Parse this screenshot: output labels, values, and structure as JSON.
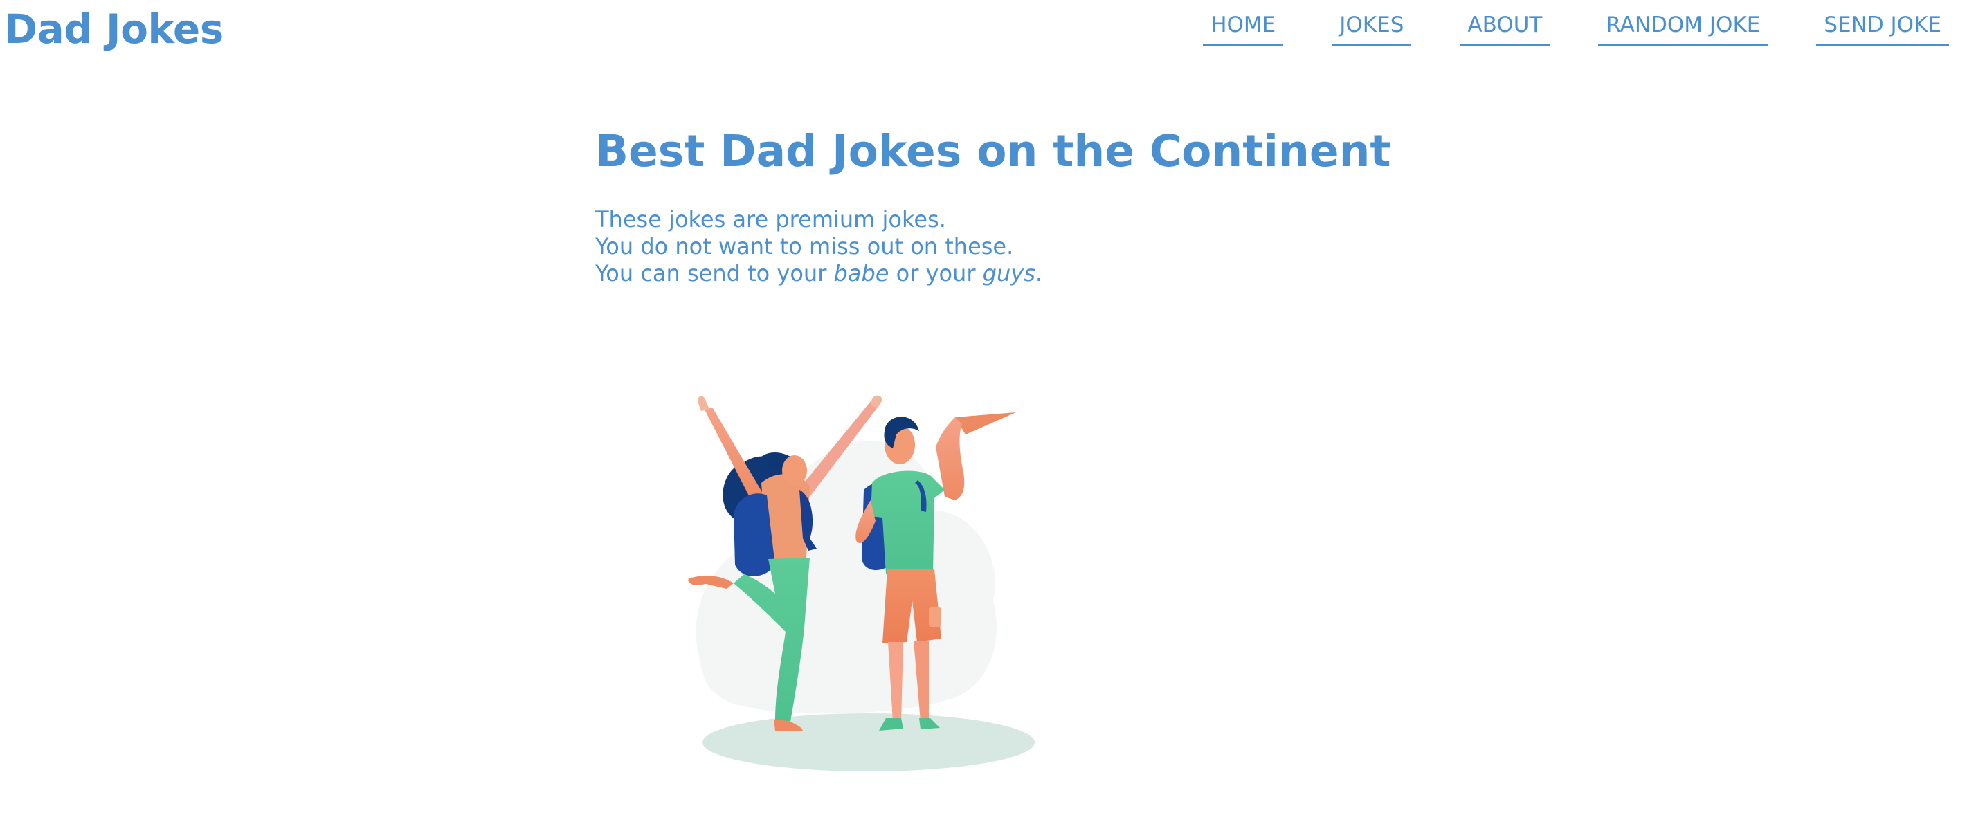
{
  "header": {
    "brand": "Dad Jokes",
    "nav": [
      {
        "label": "HOME"
      },
      {
        "label": "JOKES"
      },
      {
        "label": "ABOUT"
      },
      {
        "label": "RANDOM JOKE"
      },
      {
        "label": "SEND JOKE"
      }
    ]
  },
  "main": {
    "title": "Best Dad Jokes on the Continent",
    "lines": {
      "line1": "These jokes are premium jokes.",
      "line2": "You do not want to miss out on these.",
      "line3_start": "You can send to your ",
      "line3_em1": "babe",
      "line3_mid": " or your ",
      "line3_em2": "guys",
      "line3_end": "."
    }
  },
  "theme": {
    "accent": "#4a8fd0",
    "background": "#ffffff"
  },
  "illustration": {
    "icon": "two-friends-celebrating-illustration"
  }
}
